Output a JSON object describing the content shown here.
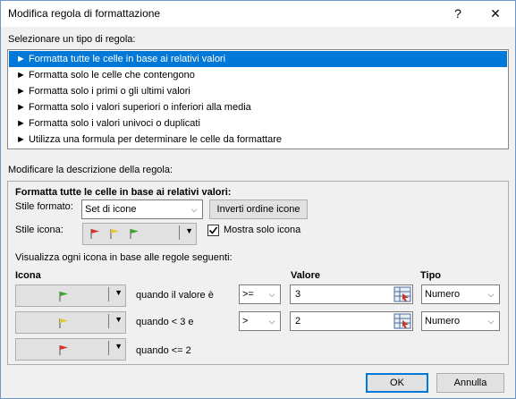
{
  "window": {
    "title": "Modifica regola di formattazione",
    "help_glyph": "?",
    "close_glyph": "✕"
  },
  "rule_type": {
    "label": "Selezionare un tipo di regola:",
    "items": [
      "► Formatta tutte le celle in base ai relativi valori",
      "► Formatta solo le celle che contengono",
      "► Formatta solo i primi o gli ultimi valori",
      "► Formatta solo i valori superiori o inferiori alla media",
      "► Formatta solo i valori univoci o duplicati",
      "► Utilizza una formula per determinare le celle da formattare"
    ],
    "selected_index": 0
  },
  "description": {
    "label": "Modificare la descrizione della regola:",
    "heading": "Formatta tutte le celle in base ai relativi valori:",
    "format_style_label": "Stile formato:",
    "format_style_value": "Set di icone",
    "reverse_button": "Inverti ordine icone",
    "icon_style_label": "Stile icona:",
    "show_icon_only_label": "Mostra solo icona",
    "show_icon_only_checked": true,
    "rules_intro": "Visualizza ogni icona in base alle regole seguenti:",
    "col_icon": "Icona",
    "col_value": "Valore",
    "col_type": "Tipo",
    "rows": [
      {
        "icon_color": "#3aa32b",
        "condition": "quando il valore è",
        "operator": ">=",
        "value": "3",
        "type": "Numero"
      },
      {
        "icon_color": "#e6c62e",
        "condition": "quando < 3 e",
        "operator": ">",
        "value": "2",
        "type": "Numero"
      },
      {
        "icon_color": "#d9302c",
        "condition": "quando <= 2"
      }
    ]
  },
  "buttons": {
    "ok": "OK",
    "cancel": "Annulla"
  },
  "colors": {
    "selection": "#0078d7",
    "flag_red": "#d9302c",
    "flag_yellow": "#e6c62e",
    "flag_green": "#3aa32b"
  }
}
